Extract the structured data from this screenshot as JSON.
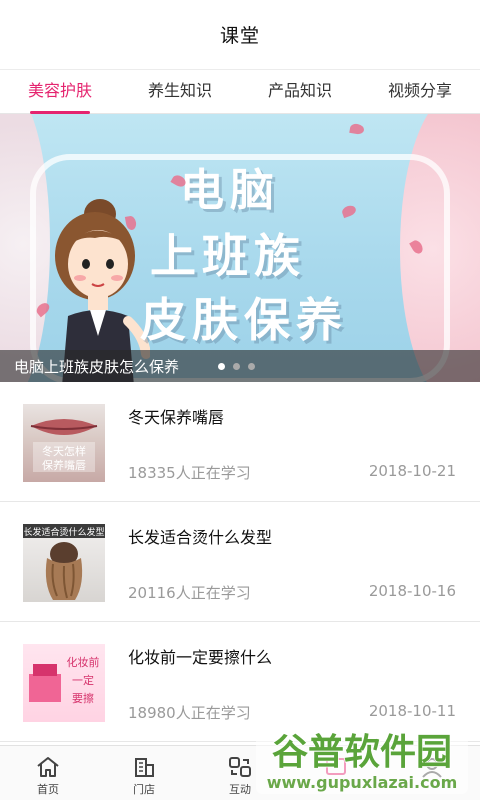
{
  "header": {
    "title": "课堂"
  },
  "tabs": [
    {
      "label": "美容护肤",
      "active": true
    },
    {
      "label": "养生知识",
      "active": false
    },
    {
      "label": "产品知识",
      "active": false
    },
    {
      "label": "视频分享",
      "active": false
    }
  ],
  "banner": {
    "line1": "电脑",
    "line2": "上班族",
    "line3": "皮肤保养",
    "caption": "电脑上班族皮肤怎么保养",
    "page_count": 3,
    "current_page": 1
  },
  "articles": [
    {
      "title": "冬天保养嘴唇",
      "learners": "18335人正在学习",
      "date": "2018-10-21",
      "thumb_text": "冬天怎样保养嘴唇"
    },
    {
      "title": "长发适合烫什么发型",
      "learners": "20116人正在学习",
      "date": "2018-10-16",
      "thumb_text": "长发适合烫什么发型"
    },
    {
      "title": "化妆前一定要擦什么",
      "learners": "18980人正在学习",
      "date": "2018-10-11",
      "thumb_text": "化妆前一定要擦"
    }
  ],
  "bottom_nav": [
    {
      "label": "首页",
      "icon": "home-icon"
    },
    {
      "label": "门店",
      "icon": "store-icon"
    },
    {
      "label": "互动",
      "icon": "interact-icon"
    },
    {
      "label": "",
      "icon": "classroom-icon"
    },
    {
      "label": "",
      "icon": "profile-icon"
    }
  ],
  "watermark": {
    "brand": "谷普软件园",
    "url": "www.gupuxlazai.com"
  },
  "colors": {
    "accent": "#e5246f",
    "banner_bg": "#a7d8ec"
  }
}
